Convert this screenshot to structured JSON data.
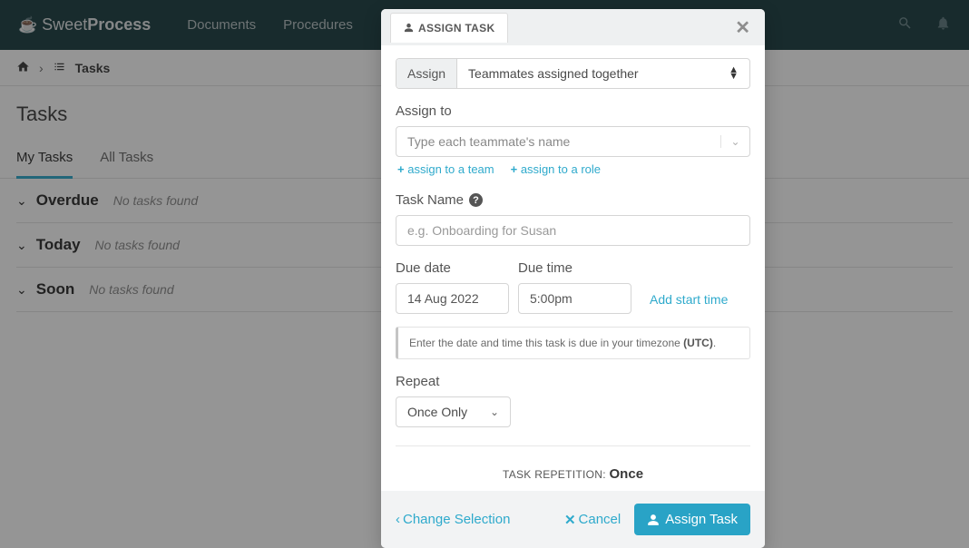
{
  "brand": {
    "sweet": "Sweet",
    "process": "Process"
  },
  "topnav": {
    "documents": "Documents",
    "procedures": "Procedures"
  },
  "breadcrumb": {
    "sep": "›",
    "tasks": "Tasks"
  },
  "page": {
    "title": "Tasks"
  },
  "tabs": {
    "my": "My Tasks",
    "all": "All Tasks"
  },
  "sections": {
    "overdue": {
      "title": "Overdue",
      "empty": "No tasks found"
    },
    "today": {
      "title": "Today",
      "empty": "No tasks found"
    },
    "soon": {
      "title": "Soon",
      "empty": "No tasks found"
    }
  },
  "modal": {
    "tab_label": "ASSIGN TASK",
    "assign_label": "Assign",
    "assign_mode": "Teammates assigned together",
    "assign_to_label": "Assign to",
    "assign_to_placeholder": "Type each teammate's name",
    "assign_team": "assign to a team",
    "assign_role": "assign to a role",
    "task_name_label": "Task Name",
    "task_name_placeholder": "e.g. Onboarding for Susan",
    "due_date_label": "Due date",
    "due_date_value": "14 Aug 2022",
    "due_time_label": "Due time",
    "due_time_value": "5:00pm",
    "add_start": "Add start time",
    "note_prefix": "Enter the date and time this task is due in your timezone ",
    "note_tz": "(UTC)",
    "note_suffix": ".",
    "repeat_label": "Repeat",
    "repeat_value": "Once Only",
    "summary_label": "TASK REPETITION: ",
    "summary_value": "Once",
    "change_sel": "Change Selection",
    "cancel": "Cancel",
    "submit": "Assign Task"
  }
}
